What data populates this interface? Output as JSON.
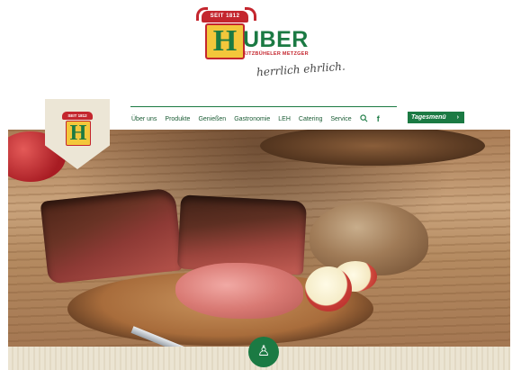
{
  "logo": {
    "since": "SEIT 1812",
    "letter": "H",
    "name": "UBER",
    "subtitle": "KITZBÜHELER METZGER",
    "slogan": "herrlich ehrlich."
  },
  "badge": {
    "since": "SEIT 1812",
    "letter": "H"
  },
  "nav": {
    "items": [
      "Über uns",
      "Produkte",
      "Genießen",
      "Gastronomie",
      "LEH",
      "Catering",
      "Service"
    ],
    "search_icon": "search-icon",
    "facebook_icon": "facebook-icon",
    "facebook_glyph": "f",
    "cta_label": "Tagesmenü",
    "cta_arrow": "›"
  },
  "hero": {
    "image": "hero-food-photo"
  },
  "strip": {
    "icon": "chef-icon",
    "glyph": "♙"
  },
  "colors": {
    "brand_green": "#1b7a43",
    "brand_red": "#c4262e",
    "brand_yellow": "#f3c73b"
  }
}
